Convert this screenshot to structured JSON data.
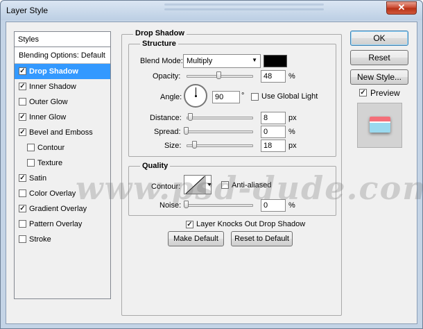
{
  "window": {
    "title": "Layer Style",
    "close_glyph": "✕"
  },
  "sidebar": {
    "header": "Styles",
    "blending_options": "Blending Options: Default",
    "items": [
      {
        "label": "Drop Shadow",
        "checked": true,
        "selected": true
      },
      {
        "label": "Inner Shadow",
        "checked": true
      },
      {
        "label": "Outer Glow",
        "checked": false
      },
      {
        "label": "Inner Glow",
        "checked": true
      },
      {
        "label": "Bevel and Emboss",
        "checked": true
      },
      {
        "label": "Contour",
        "checked": false,
        "indent": true
      },
      {
        "label": "Texture",
        "checked": false,
        "indent": true
      },
      {
        "label": "Satin",
        "checked": true
      },
      {
        "label": "Color Overlay",
        "checked": false
      },
      {
        "label": "Gradient Overlay",
        "checked": true
      },
      {
        "label": "Pattern Overlay",
        "checked": false
      },
      {
        "label": "Stroke",
        "checked": false
      }
    ]
  },
  "drop_shadow": {
    "title": "Drop Shadow",
    "structure": {
      "title": "Structure",
      "blend_mode_label": "Blend Mode:",
      "blend_mode_value": "Multiply",
      "shadow_color": "#000000",
      "opacity_label": "Opacity:",
      "opacity_value": "48",
      "opacity_unit": "%",
      "angle_label": "Angle:",
      "angle_value": "90",
      "angle_unit": "°",
      "global_light_label": "Use Global Light",
      "global_light_checked": false,
      "distance_label": "Distance:",
      "distance_value": "8",
      "distance_unit": "px",
      "spread_label": "Spread:",
      "spread_value": "0",
      "spread_unit": "%",
      "size_label": "Size:",
      "size_value": "18",
      "size_unit": "px"
    },
    "quality": {
      "title": "Quality",
      "contour_label": "Contour:",
      "anti_aliased_label": "Anti-aliased",
      "anti_aliased_checked": false,
      "noise_label": "Noise:",
      "noise_value": "0",
      "noise_unit": "%"
    },
    "knockout_label": "Layer Knocks Out Drop Shadow",
    "knockout_checked": true,
    "make_default": "Make Default",
    "reset_to_default": "Reset to Default"
  },
  "actions": {
    "ok": "OK",
    "reset": "Reset",
    "new_style": "New Style...",
    "preview_label": "Preview",
    "preview_checked": true
  },
  "watermark": "www.psd-dude.com"
}
